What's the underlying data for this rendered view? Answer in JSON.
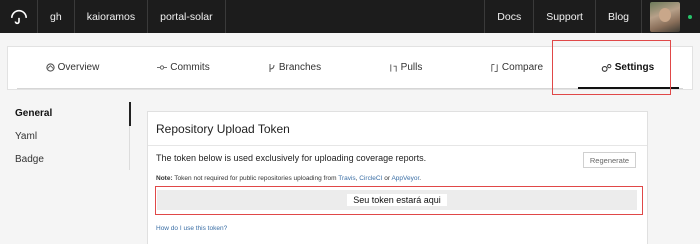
{
  "topbar": {
    "logo_icon": "umbrella-logo-icon",
    "left_items": [
      "gh",
      "kaioramos",
      "portal-solar"
    ],
    "right_items": [
      "Docs",
      "Support",
      "Blog"
    ],
    "status_color": "#27c46a"
  },
  "tabs": [
    {
      "label": "Overview",
      "icon": "overview-icon"
    },
    {
      "label": "Commits",
      "icon": "commits-icon"
    },
    {
      "label": "Branches",
      "icon": "branches-icon"
    },
    {
      "label": "Pulls",
      "icon": "pulls-icon"
    },
    {
      "label": "Compare",
      "icon": "compare-icon"
    },
    {
      "label": "Settings",
      "icon": "gears-icon",
      "active": true
    }
  ],
  "sidenav": {
    "items": [
      {
        "label": "General",
        "active": true
      },
      {
        "label": "Yaml"
      },
      {
        "label": "Badge"
      }
    ]
  },
  "panel": {
    "title": "Repository Upload Token",
    "description": "The token below is used exclusively for uploading coverage reports.",
    "regenerate_label": "Regenerate",
    "note_prefix": "Note:",
    "note_text": " Token not required for public repositories uploading from ",
    "note_links": [
      "Travis",
      "CircleCI",
      "AppVeyor"
    ],
    "note_or": " or ",
    "note_suffix": ".",
    "token_value": "Seu token estará aqui",
    "help_link": "How do I use this token?"
  },
  "highlight_color": "#e04848"
}
